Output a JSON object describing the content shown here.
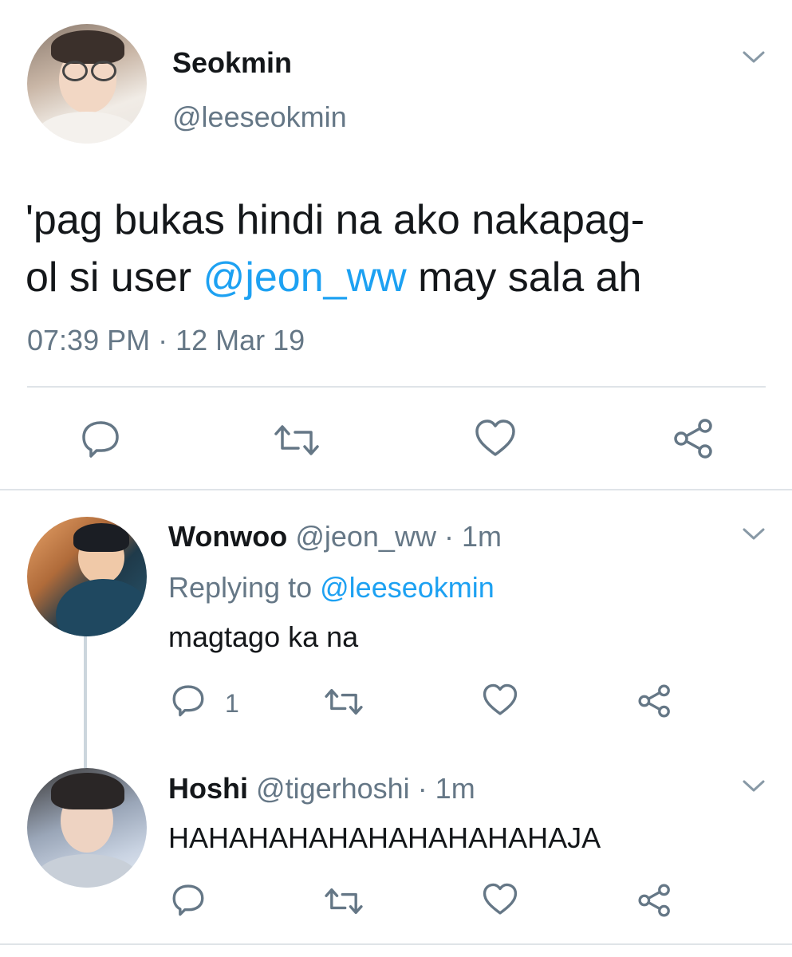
{
  "main_tweet": {
    "display_name": "Seokmin",
    "handle": "@leeseokmin",
    "text_before": "'pag bukas hindi na ako nakapag-",
    "text_line2_before": "ol si user ",
    "mention": "@jeon_ww",
    "text_after": " may sala ah",
    "timestamp": "07:39 PM · 12 Mar 19",
    "actions": [
      "reply-icon",
      "retweet-icon",
      "like-icon",
      "share-icon"
    ]
  },
  "replies": [
    {
      "display_name": "Wonwoo",
      "handle": "@jeon_ww",
      "time": "· 1m",
      "replying_prefix": "Replying to",
      "replying_handle": "@leeseokmin",
      "text": "magtago ka na",
      "reply_count": "1"
    },
    {
      "display_name": "Hoshi",
      "handle": "@tigerhoshi",
      "time": "· 1m",
      "text": "HAHAHAHAHAHAHAHAHAHAJA",
      "reply_count": ""
    }
  ],
  "colors": {
    "text": "#14171a",
    "secondary": "#657786",
    "link": "#1da1f2",
    "divider": "#dfe4e8"
  }
}
